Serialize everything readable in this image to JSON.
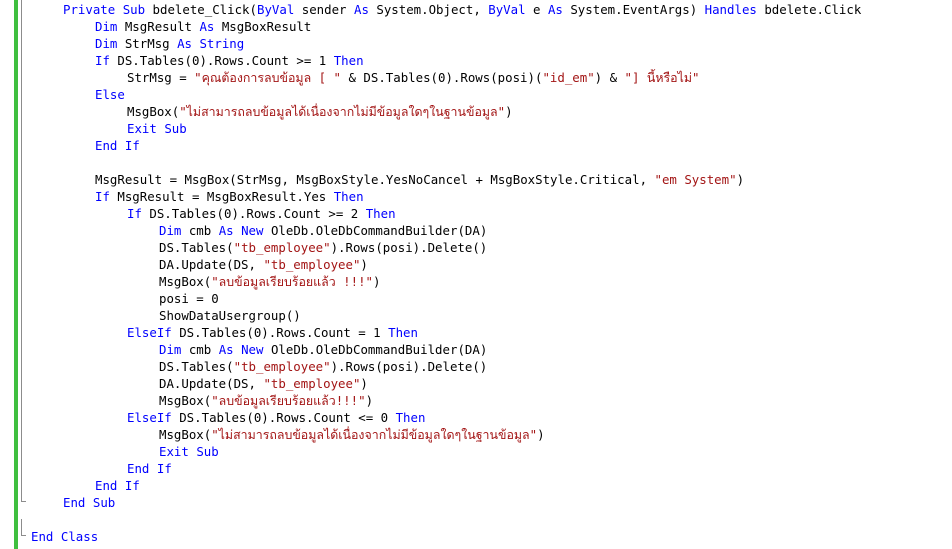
{
  "editor": {
    "lines": [
      {
        "tokens": [
          {
            "t": "Private",
            "k": "kw"
          },
          {
            "t": " "
          },
          {
            "t": "Sub",
            "k": "kw"
          },
          {
            "t": " bdelete_Click("
          },
          {
            "t": "ByVal",
            "k": "kw"
          },
          {
            "t": " sender "
          },
          {
            "t": "As",
            "k": "kw"
          },
          {
            "t": " System.Object, "
          },
          {
            "t": "ByVal",
            "k": "kw"
          },
          {
            "t": " e "
          },
          {
            "t": "As",
            "k": "kw"
          },
          {
            "t": " System.EventArgs) "
          },
          {
            "t": "Handles",
            "k": "kw"
          },
          {
            "t": " bdelete.Click"
          }
        ]
      },
      {
        "tokens": [
          {
            "t": "Dim",
            "k": "kw"
          },
          {
            "t": " MsgResult "
          },
          {
            "t": "As",
            "k": "kw"
          },
          {
            "t": " MsgBoxResult"
          }
        ]
      },
      {
        "tokens": [
          {
            "t": "Dim",
            "k": "kw"
          },
          {
            "t": " StrMsg "
          },
          {
            "t": "As",
            "k": "kw"
          },
          {
            "t": " "
          },
          {
            "t": "String",
            "k": "kw"
          }
        ]
      },
      {
        "tokens": [
          {
            "t": "If",
            "k": "kw"
          },
          {
            "t": " DS.Tables(0).Rows.Count >= 1 "
          },
          {
            "t": "Then",
            "k": "kw"
          }
        ]
      },
      {
        "tokens": [
          {
            "t": "StrMsg = "
          },
          {
            "t": "\"คุณต้องการลบข้อมูล [ \"",
            "k": "str"
          },
          {
            "t": " & DS.Tables(0).Rows(posi)("
          },
          {
            "t": "\"id_em\"",
            "k": "str"
          },
          {
            "t": ") & "
          },
          {
            "t": "\"] นี้หรือไม่\"",
            "k": "str"
          }
        ]
      },
      {
        "tokens": [
          {
            "t": "Else",
            "k": "kw"
          }
        ]
      },
      {
        "tokens": [
          {
            "t": "MsgBox("
          },
          {
            "t": "\"ไม่สามารถลบข้อมูลได้เนื่องจากไม่มีข้อมูลใดๆในฐานข้อมูล\"",
            "k": "str"
          },
          {
            "t": ")"
          }
        ]
      },
      {
        "tokens": [
          {
            "t": "Exit",
            "k": "kw"
          },
          {
            "t": " "
          },
          {
            "t": "Sub",
            "k": "kw"
          }
        ]
      },
      {
        "tokens": [
          {
            "t": "End",
            "k": "kw"
          },
          {
            "t": " "
          },
          {
            "t": "If",
            "k": "kw"
          }
        ]
      },
      {
        "tokens": []
      },
      {
        "tokens": [
          {
            "t": "MsgResult = MsgBox(StrMsg, MsgBoxStyle.YesNoCancel + MsgBoxStyle.Critical, "
          },
          {
            "t": "\"em System\"",
            "k": "str"
          },
          {
            "t": ")"
          }
        ]
      },
      {
        "tokens": [
          {
            "t": "If",
            "k": "kw"
          },
          {
            "t": " MsgResult = MsgBoxResult.Yes "
          },
          {
            "t": "Then",
            "k": "kw"
          }
        ]
      },
      {
        "tokens": [
          {
            "t": "If",
            "k": "kw"
          },
          {
            "t": " DS.Tables(0).Rows.Count >= 2 "
          },
          {
            "t": "Then",
            "k": "kw"
          }
        ]
      },
      {
        "tokens": [
          {
            "t": "Dim",
            "k": "kw"
          },
          {
            "t": " cmb "
          },
          {
            "t": "As",
            "k": "kw"
          },
          {
            "t": " "
          },
          {
            "t": "New",
            "k": "kw"
          },
          {
            "t": " OleDb.OleDbCommandBuilder(DA)"
          }
        ]
      },
      {
        "tokens": [
          {
            "t": "DS.Tables("
          },
          {
            "t": "\"tb_employee\"",
            "k": "str"
          },
          {
            "t": ").Rows(posi).Delete()"
          }
        ]
      },
      {
        "tokens": [
          {
            "t": "DA.Update(DS, "
          },
          {
            "t": "\"tb_employee\"",
            "k": "str"
          },
          {
            "t": ")"
          }
        ]
      },
      {
        "tokens": [
          {
            "t": "MsgBox("
          },
          {
            "t": "\"ลบข้อมูลเรียบร้อยแล้ว !!!\"",
            "k": "str"
          },
          {
            "t": ")"
          }
        ]
      },
      {
        "tokens": [
          {
            "t": "posi = 0"
          }
        ]
      },
      {
        "tokens": [
          {
            "t": "ShowDataUsergroup()"
          }
        ]
      },
      {
        "tokens": [
          {
            "t": "ElseIf",
            "k": "kw"
          },
          {
            "t": " DS.Tables(0).Rows.Count = 1 "
          },
          {
            "t": "Then",
            "k": "kw"
          }
        ]
      },
      {
        "tokens": [
          {
            "t": "Dim",
            "k": "kw"
          },
          {
            "t": " cmb "
          },
          {
            "t": "As",
            "k": "kw"
          },
          {
            "t": " "
          },
          {
            "t": "New",
            "k": "kw"
          },
          {
            "t": " OleDb.OleDbCommandBuilder(DA)"
          }
        ]
      },
      {
        "tokens": [
          {
            "t": "DS.Tables("
          },
          {
            "t": "\"tb_employee\"",
            "k": "str"
          },
          {
            "t": ").Rows(posi).Delete()"
          }
        ]
      },
      {
        "tokens": [
          {
            "t": "DA.Update(DS, "
          },
          {
            "t": "\"tb_employee\"",
            "k": "str"
          },
          {
            "t": ")"
          }
        ]
      },
      {
        "tokens": [
          {
            "t": "MsgBox("
          },
          {
            "t": "\"ลบข้อมูลเรียบร้อยแล้ว!!!\"",
            "k": "str"
          },
          {
            "t": ")"
          }
        ]
      },
      {
        "tokens": [
          {
            "t": "ElseIf",
            "k": "kw"
          },
          {
            "t": " DS.Tables(0).Rows.Count <= 0 "
          },
          {
            "t": "Then",
            "k": "kw"
          }
        ]
      },
      {
        "tokens": [
          {
            "t": "MsgBox("
          },
          {
            "t": "\"ไม่สามารถลบข้อมูลได้เนื่องจากไม่มีข้อมูลใดๆในฐานข้อมูล\"",
            "k": "str"
          },
          {
            "t": ")"
          }
        ]
      },
      {
        "tokens": [
          {
            "t": "Exit",
            "k": "kw"
          },
          {
            "t": " "
          },
          {
            "t": "Sub",
            "k": "kw"
          }
        ]
      },
      {
        "tokens": [
          {
            "t": "End",
            "k": "kw"
          },
          {
            "t": " "
          },
          {
            "t": "If",
            "k": "kw"
          }
        ]
      },
      {
        "tokens": [
          {
            "t": "End",
            "k": "kw"
          },
          {
            "t": " "
          },
          {
            "t": "If",
            "k": "kw"
          }
        ]
      },
      {
        "tokens": [
          {
            "t": "End",
            "k": "kw"
          },
          {
            "t": " "
          },
          {
            "t": "Sub",
            "k": "kw"
          }
        ]
      },
      {
        "tokens": []
      },
      {
        "tokens": [
          {
            "t": "End",
            "k": "kw"
          },
          {
            "t": " "
          },
          {
            "t": "Class",
            "k": "kw"
          }
        ]
      }
    ]
  },
  "colors": {
    "keyword": "#0000ff",
    "string": "#a31515",
    "identifier": "#000000",
    "changed_margin": "#3fbf3f",
    "outline": "#8c8c8c"
  }
}
